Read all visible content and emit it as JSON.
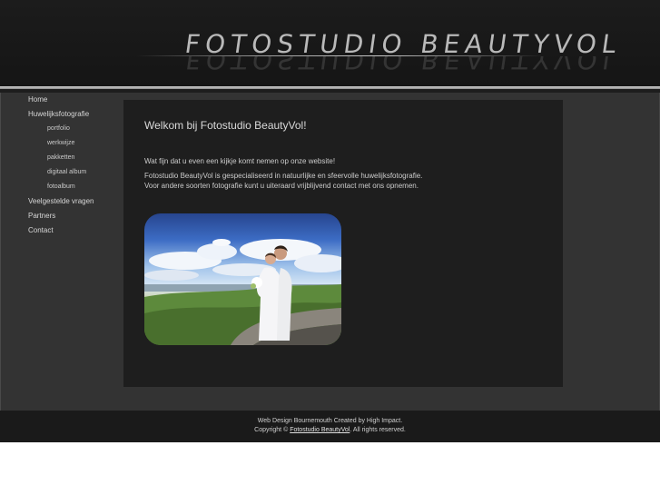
{
  "header": {
    "logo_text": "FOTOSTUDIO BEAUTYVOL"
  },
  "sidebar": {
    "items": [
      {
        "label": "Home"
      },
      {
        "label": "Huwelijksfotografie"
      },
      {
        "label": "portfolio"
      },
      {
        "label": "werkwijze"
      },
      {
        "label": "pakketten"
      },
      {
        "label": "digitaal album"
      },
      {
        "label": "fotoalbum"
      },
      {
        "label": "Veelgestelde vragen"
      },
      {
        "label": "Partners"
      },
      {
        "label": "Contact"
      }
    ]
  },
  "main": {
    "title": "Welkom bij Fotostudio BeautyVol!",
    "intro": "Wat fijn dat u even een kijkje komt nemen op onze website!",
    "paragraph_line1": "Fotostudio BeautyVol is gespecialiseerd in natuurlijke en sfeervolle huwelijksfotografie.",
    "paragraph_line2": "Voor andere soorten fotografie kunt u uiteraard vrijblijvend contact met ons opnemen."
  },
  "footer": {
    "line1": "Web Design Bournemouth Created by High Impact.",
    "copyright_prefix": "Copyright ©",
    "copyright_link": "Fotostudio BeautyVol",
    "copyright_suffix": ". All rights reserved."
  }
}
